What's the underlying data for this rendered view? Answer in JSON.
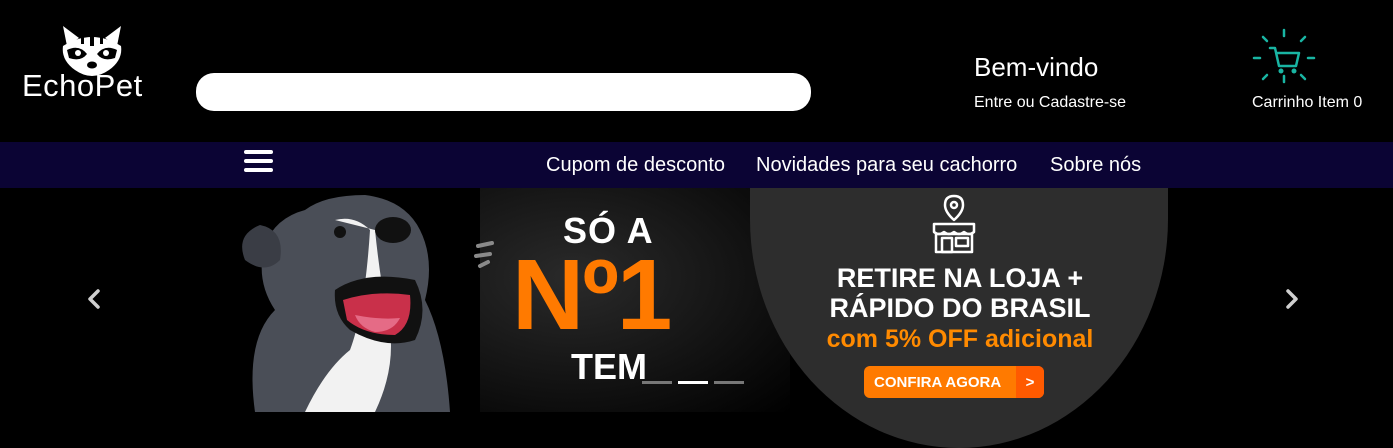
{
  "header": {
    "logo_text": "EchoPet",
    "search_placeholder": "",
    "welcome_title": "Bem-vindo",
    "login_link": "Entre ou Cadastre-se",
    "cart_label": "Carrinho Item 0"
  },
  "nav": {
    "menu_icon": "hamburger-icon",
    "links": [
      "Cupom de desconto",
      "Novidades para seu cachorro",
      "Sobre nós"
    ]
  },
  "banner": {
    "headline_top": "SÓ A",
    "headline_main": "Nº1",
    "headline_bottom": "TEM",
    "offer_line1": "RETIRE NA LOJA +",
    "offer_line2": "RÁPIDO DO BRASIL",
    "offer_discount": "com 5% OFF adicional",
    "cta_label": "CONFIRA AGORA",
    "cta_arrow": ">",
    "slides": 3,
    "active_slide": 2
  },
  "colors": {
    "nav_bg": "#0b0434",
    "accent_orange": "#ff7a00",
    "cart_teal": "#19b5a3"
  }
}
